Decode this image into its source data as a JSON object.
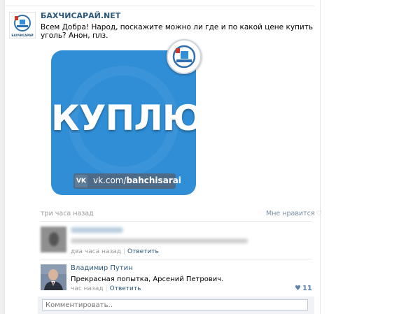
{
  "post": {
    "author": "БАХЧИСАРАЙ.NET",
    "avatar_caption": "БАХЧИСАРАЙ",
    "text": "Всем Добра! Народ, поскажите можно ли где и по какой цене купить уголь? Анон, плз.",
    "time": "три часа назад",
    "like_label": "Мне нравится"
  },
  "banner": {
    "title": "КУПЛЮ",
    "vk_logo": "VK",
    "url_prefix": "vk.com/",
    "url_name": "bahchisarai",
    "bg_color": "#2f8ed6"
  },
  "comments": [
    {
      "time": "два часа назад",
      "reply": "Ответить"
    },
    {
      "name": "Владимир Путин",
      "text": "Прекрасная попытка, Арсений Петрович.",
      "time": "час назад",
      "reply": "Ответить",
      "likes": "11"
    }
  ],
  "composer": {
    "placeholder": "Комментировать.."
  },
  "icons": {
    "like": "heart-outline-icon",
    "liked": "heart-filled-icon",
    "logo": "bahchisarai-logo-icon"
  }
}
